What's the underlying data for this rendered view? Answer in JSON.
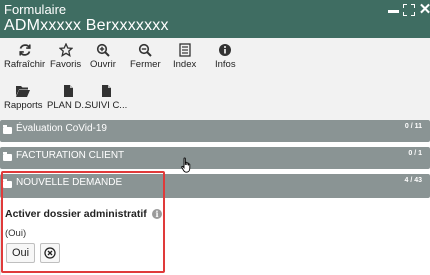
{
  "header": {
    "title": "Formulaire",
    "subtitle": "ADMxxxxx Berxxxxxxx",
    "icons": [
      "minimize-icon",
      "maximize-icon",
      "close-icon"
    ],
    "color": "#3f6d62"
  },
  "toolbar": {
    "row1": [
      {
        "label": "Rafraîchir",
        "icon": "refresh-icon"
      },
      {
        "label": "Favoris",
        "icon": "star-icon"
      },
      {
        "label": "Ouvrir",
        "icon": "zoom-in-icon"
      },
      {
        "label": "Fermer",
        "icon": "zoom-out-icon"
      },
      {
        "label": "Index",
        "icon": "list-icon"
      },
      {
        "label": "Infos",
        "icon": "info-icon"
      }
    ],
    "row2": [
      {
        "label": "Rapports",
        "icon": "folder-open-icon"
      },
      {
        "label": "PLAN D...",
        "icon": "document-icon"
      },
      {
        "label": "SUIVI C...",
        "icon": "document-icon"
      }
    ]
  },
  "sections": [
    {
      "label": "Évaluation CoVid-19",
      "count": "0 / 11"
    },
    {
      "label": "FACTURATION CLIENT",
      "count": "0 / 1"
    },
    {
      "label": "NOUVELLE DEMANDE",
      "count": "4 / 43"
    }
  ],
  "form": {
    "field_label": "Activer dossier administratif",
    "field_value": "(Oui)",
    "button_label": "Oui"
  },
  "colors": {
    "section_bg": "#8a9494",
    "highlight": "#e03a3a"
  }
}
